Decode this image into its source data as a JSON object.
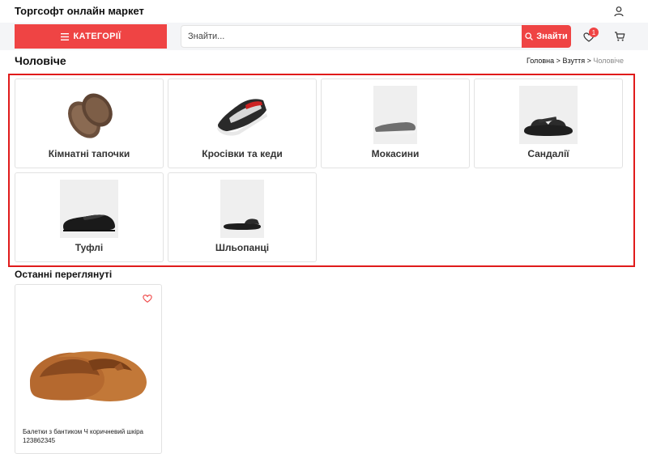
{
  "header": {
    "brand": "Торгсофт онлайн маркет",
    "categories_label": "КАТЕГОРІЇ",
    "search_placeholder": "Знайти...",
    "search_button": "Знайти",
    "wishlist_count": "1",
    "icons": [
      "user-icon",
      "menu-icon",
      "search-icon",
      "heart-icon",
      "cart-icon"
    ]
  },
  "page": {
    "title": "Чоловіче",
    "breadcrumb": [
      "Головна",
      "Взуття",
      "Чоловіче"
    ]
  },
  "categories": [
    {
      "label": "Кімнатні тапочки"
    },
    {
      "label": "Кросівки та кеди"
    },
    {
      "label": "Мокасини"
    },
    {
      "label": "Сандалії"
    },
    {
      "label": "Туфлі"
    },
    {
      "label": "Шльопанці"
    }
  ],
  "recent": {
    "title": "Останні переглянуті",
    "items": [
      {
        "name": "Балетки з бантиком Ч коричневий шкіра",
        "code": "123862345"
      }
    ]
  },
  "colors": {
    "accent": "#ef4444",
    "frame": "#e01b1b"
  }
}
